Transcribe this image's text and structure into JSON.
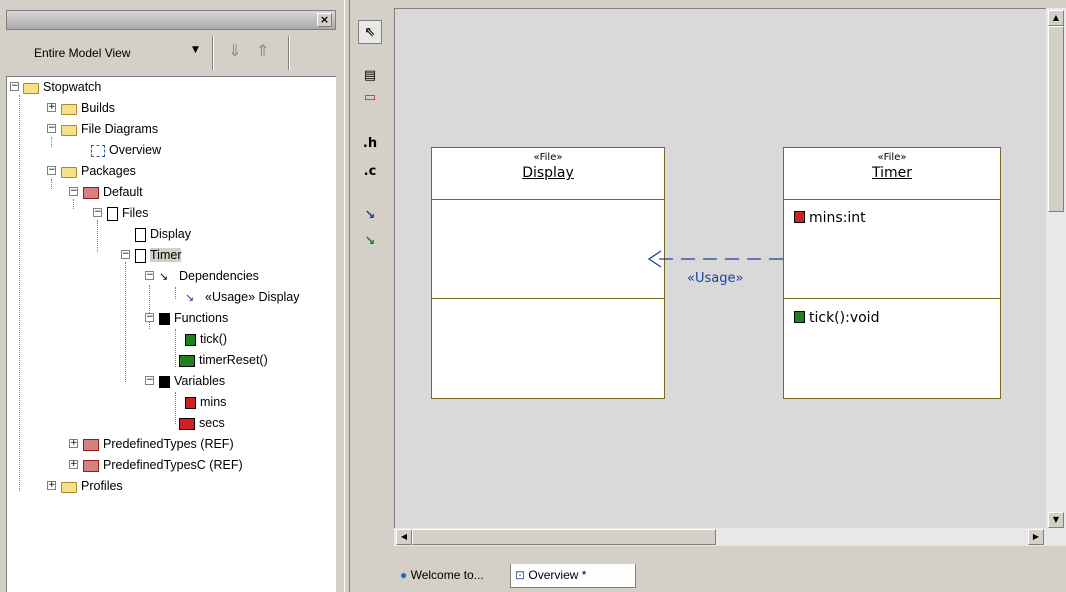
{
  "panel": {
    "close_label": "×",
    "view_label": "Entire Model View",
    "view_dropdown": "▼",
    "down_arrow": "⇓",
    "up_arrow": "⇑"
  },
  "tree": {
    "root": "Stopwatch",
    "builds": "Builds",
    "file_diagrams": "File Diagrams",
    "overview": "Overview",
    "packages": "Packages",
    "default": "Default",
    "files": "Files",
    "display": "Display",
    "timer": "Timer",
    "dependencies": "Dependencies",
    "usage_display": "«Usage» Display",
    "functions": "Functions",
    "tick": "tick()",
    "timer_reset": "timerReset()",
    "variables": "Variables",
    "mins": "mins",
    "secs": "secs",
    "predefined_types": "PredefinedTypes (REF)",
    "predefined_types_c": "PredefinedTypesC (REF)",
    "profiles": "Profiles"
  },
  "toolbox": {
    "pointer": "⇖",
    "file": "▤",
    "folder": "▭",
    "h_tool": ".h",
    "c_tool": ".c",
    "dependency": "↘",
    "flow": "↘"
  },
  "diagram": {
    "display_box": {
      "stereotype": "«File»",
      "name": "Display"
    },
    "timer_box": {
      "stereotype": "«File»",
      "name": "Timer",
      "attribute": "mins:int",
      "operation": "tick():void"
    },
    "usage_label": "«Usage»"
  },
  "tabs": {
    "welcome": "Welcome to...",
    "overview": "Overview *"
  },
  "colors": {
    "canvas": "#d9d9d9",
    "box_border": "#7a6a20",
    "usage_arrow": "#1f3f9f",
    "attr_icon": "#d02020",
    "op_icon": "#208020"
  }
}
